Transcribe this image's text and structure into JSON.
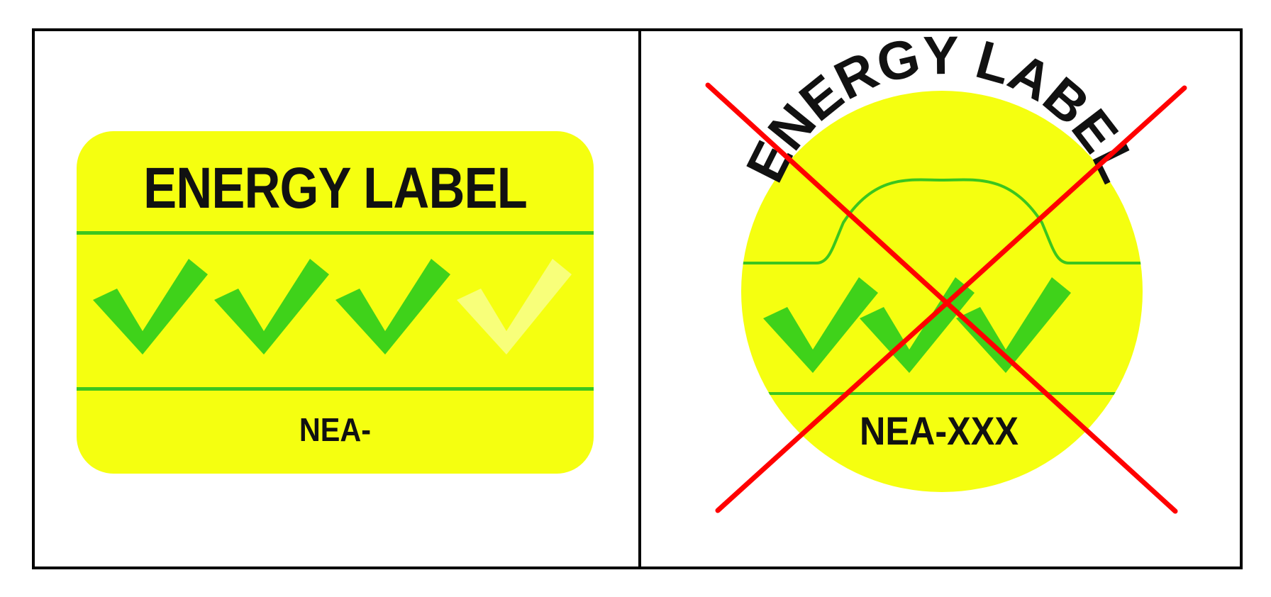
{
  "approved_label": {
    "title": "ENERGY LABEL",
    "code": "NEA-",
    "check_count_filled": 3,
    "check_count_total": 4
  },
  "rejected_label": {
    "title": "ENERGY LABEL",
    "code": "NEA-XXX",
    "check_count": 3,
    "crossed_out": true
  },
  "colors": {
    "label_yellow": "#f5ff10",
    "check_green": "#3fd21a",
    "check_faded": "#f8ff7a",
    "cross_red": "#ff0000",
    "border": "#000000"
  }
}
